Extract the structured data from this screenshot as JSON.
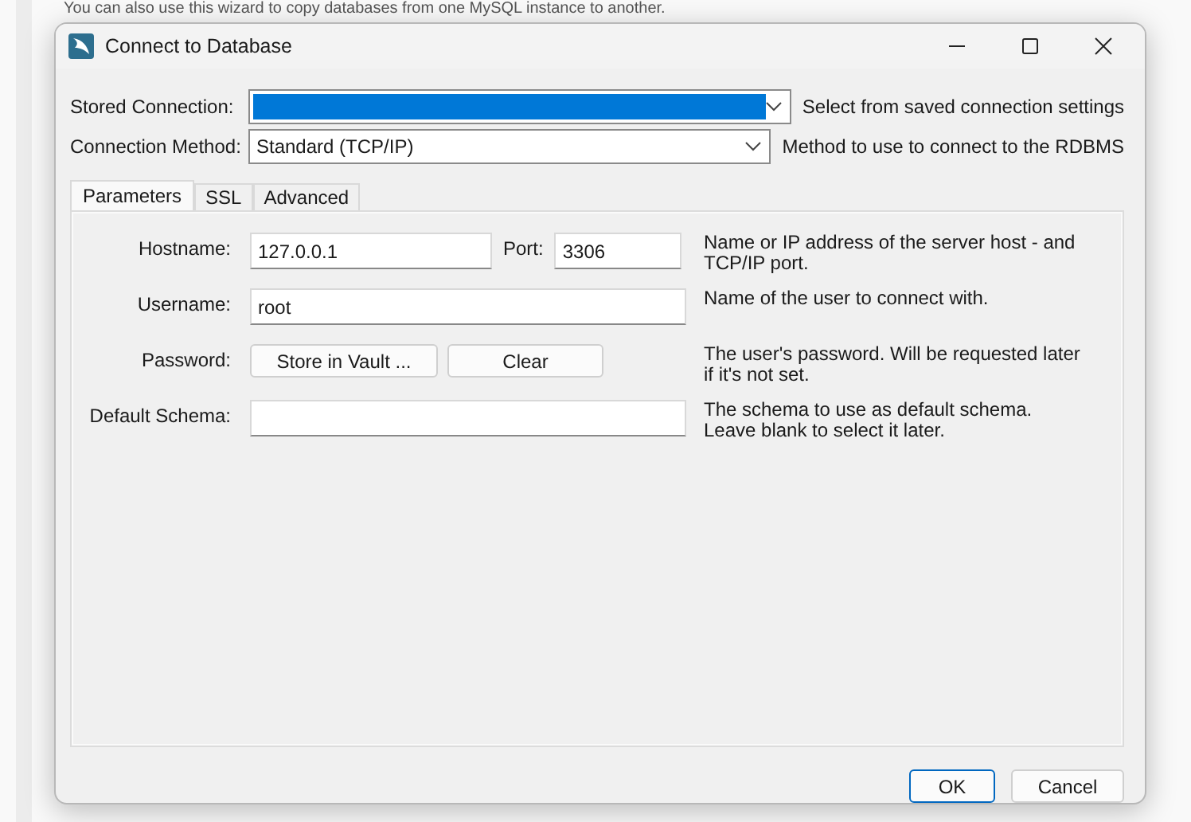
{
  "background_text": "You can also use this wizard to copy databases from one MySQL instance to another.",
  "window": {
    "title": "Connect to Database"
  },
  "connection_rows": [
    {
      "label": "Stored Connection:",
      "highlighted": true,
      "description": "Select from saved connection settings"
    },
    {
      "label": "Connection Method:",
      "value": "Standard (TCP/IP)",
      "highlighted": false,
      "description": "Method to use to connect to the RDBMS"
    }
  ],
  "tabs": [
    {
      "label": "Parameters",
      "selected": true
    },
    {
      "label": "SSL",
      "selected": false
    },
    {
      "label": "Advanced",
      "selected": false
    }
  ],
  "parameters": [
    {
      "kind": "host_port",
      "label": "Hostname:",
      "value": "127.0.0.1",
      "port_label": "Port:",
      "port_value": "3306",
      "description": "Name or IP address of the server host - and TCP/IP port."
    },
    {
      "kind": "text",
      "label": "Username:",
      "value": "root",
      "description": "Name of the user to connect with."
    },
    {
      "kind": "buttons",
      "label": "Password:",
      "buttons": [
        "Store in Vault ...",
        "Clear"
      ],
      "description": "The user's password. Will be requested later if it's not set."
    },
    {
      "kind": "text",
      "label": "Default Schema:",
      "description": "The schema to use as default schema. Leave blank to select it later."
    }
  ],
  "dialog_buttons": [
    {
      "label": "OK",
      "default": true
    },
    {
      "label": "Cancel",
      "default": false
    }
  ]
}
